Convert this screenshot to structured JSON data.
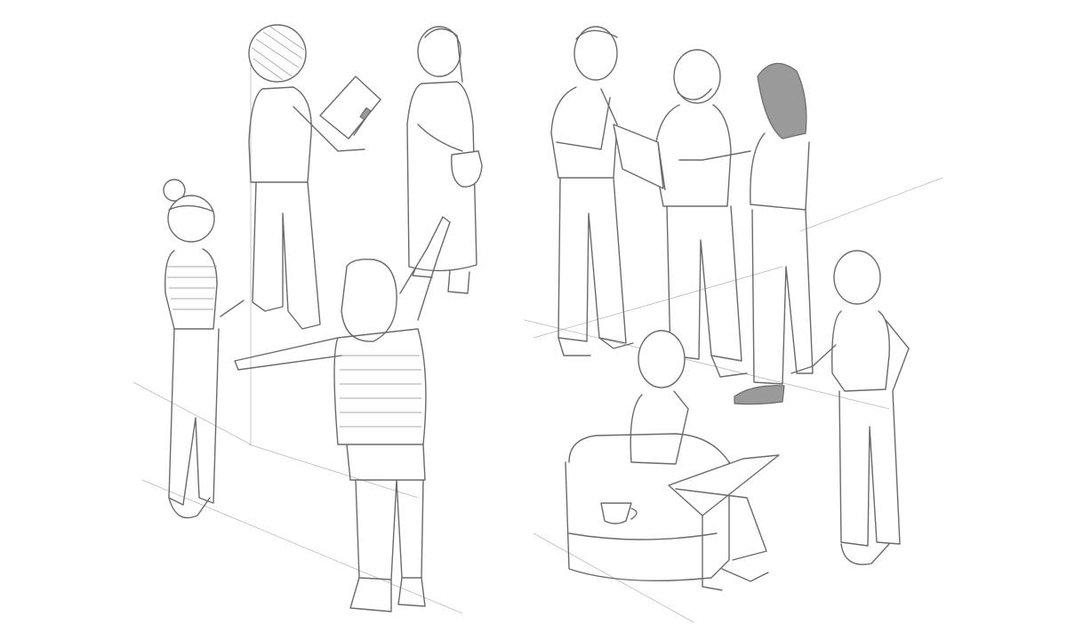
{
  "scene": {
    "kind": "pencil-sketch",
    "background": "#ffffff",
    "stroke": "#6a6a6a",
    "construction_stroke": "#b9b9b9",
    "figures": [
      "person-writing-on-clipboard",
      "woman-with-shoulder-bag",
      "woman-thinking-with-pencil",
      "person-pointing-arms-raised",
      "man-hand-on-chin",
      "bearded-man-with-laptop",
      "long-haired-woman-pointing",
      "person-hand-on-hip",
      "man-on-sofa-with-laptop"
    ],
    "props": [
      "clipboard",
      "pencil",
      "shoulder-bag",
      "tablet",
      "laptop",
      "sofa",
      "coffee-cup"
    ]
  }
}
